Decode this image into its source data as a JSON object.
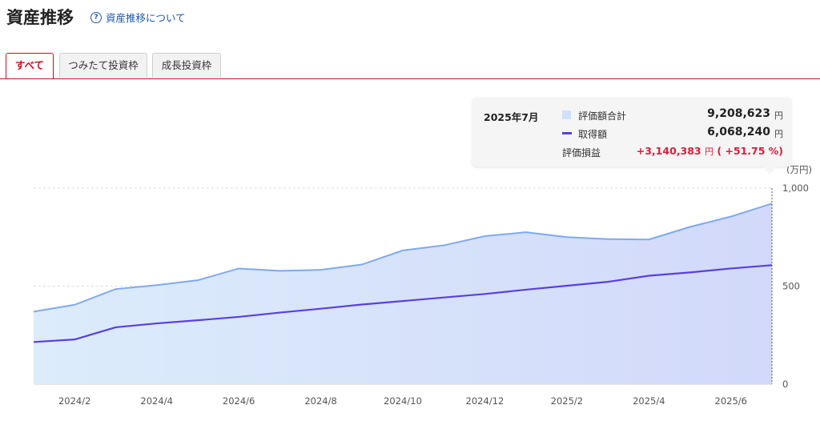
{
  "header": {
    "title": "資産推移",
    "help_link": "資産推移について",
    "help_icon": "question-circle-icon"
  },
  "tabs": [
    {
      "label": "すべて",
      "active": true
    },
    {
      "label": "つみたて投資枠",
      "active": false
    },
    {
      "label": "成長投資枠",
      "active": false
    }
  ],
  "colors": {
    "accent_red": "#c8101e",
    "area_fill": "#d6e6fb",
    "valuation_line": "#7eaaf0",
    "acquisition_line": "#5a3fe0",
    "gain_red": "#d81e3a",
    "link_blue": "#1f5aa8"
  },
  "tooltip": {
    "month": "2025年7月",
    "valuation_label": "評価額合計",
    "valuation_value": "9,208,623",
    "acquisition_label": "取得額",
    "acquisition_value": "6,068,240",
    "gain_label": "評価損益",
    "gain_value": "+3,140,383",
    "gain_pct": "( +51.75 %)",
    "unit": "円"
  },
  "chart_data": {
    "type": "area",
    "yunit": "(万円)",
    "ylim": [
      0,
      1000
    ],
    "yticks": [
      0,
      500,
      1000
    ],
    "yticklabels": [
      "0",
      "500",
      "1,000"
    ],
    "grid": true,
    "x": [
      "2024/1",
      "2024/2",
      "2024/3",
      "2024/4",
      "2024/5",
      "2024/6",
      "2024/7",
      "2024/8",
      "2024/9",
      "2024/10",
      "2024/11",
      "2024/12",
      "2025/1",
      "2025/2",
      "2025/3",
      "2025/4",
      "2025/5",
      "2025/6",
      "2025/7"
    ],
    "xticklabels": [
      "2024/2",
      "2024/4",
      "2024/6",
      "2024/8",
      "2024/10",
      "2024/12",
      "2025/2",
      "2025/4",
      "2025/6"
    ],
    "series": [
      {
        "name": "評価額合計",
        "style": "area",
        "values": [
          370,
          405,
          485,
          505,
          530,
          590,
          578,
          583,
          610,
          682,
          708,
          755,
          775,
          750,
          740,
          738,
          802,
          855,
          921
        ]
      },
      {
        "name": "取得額",
        "style": "line",
        "values": [
          215,
          228,
          290,
          310,
          326,
          343,
          365,
          385,
          406,
          424,
          442,
          460,
          482,
          502,
          522,
          553,
          570,
          590,
          607
        ]
      }
    ]
  }
}
